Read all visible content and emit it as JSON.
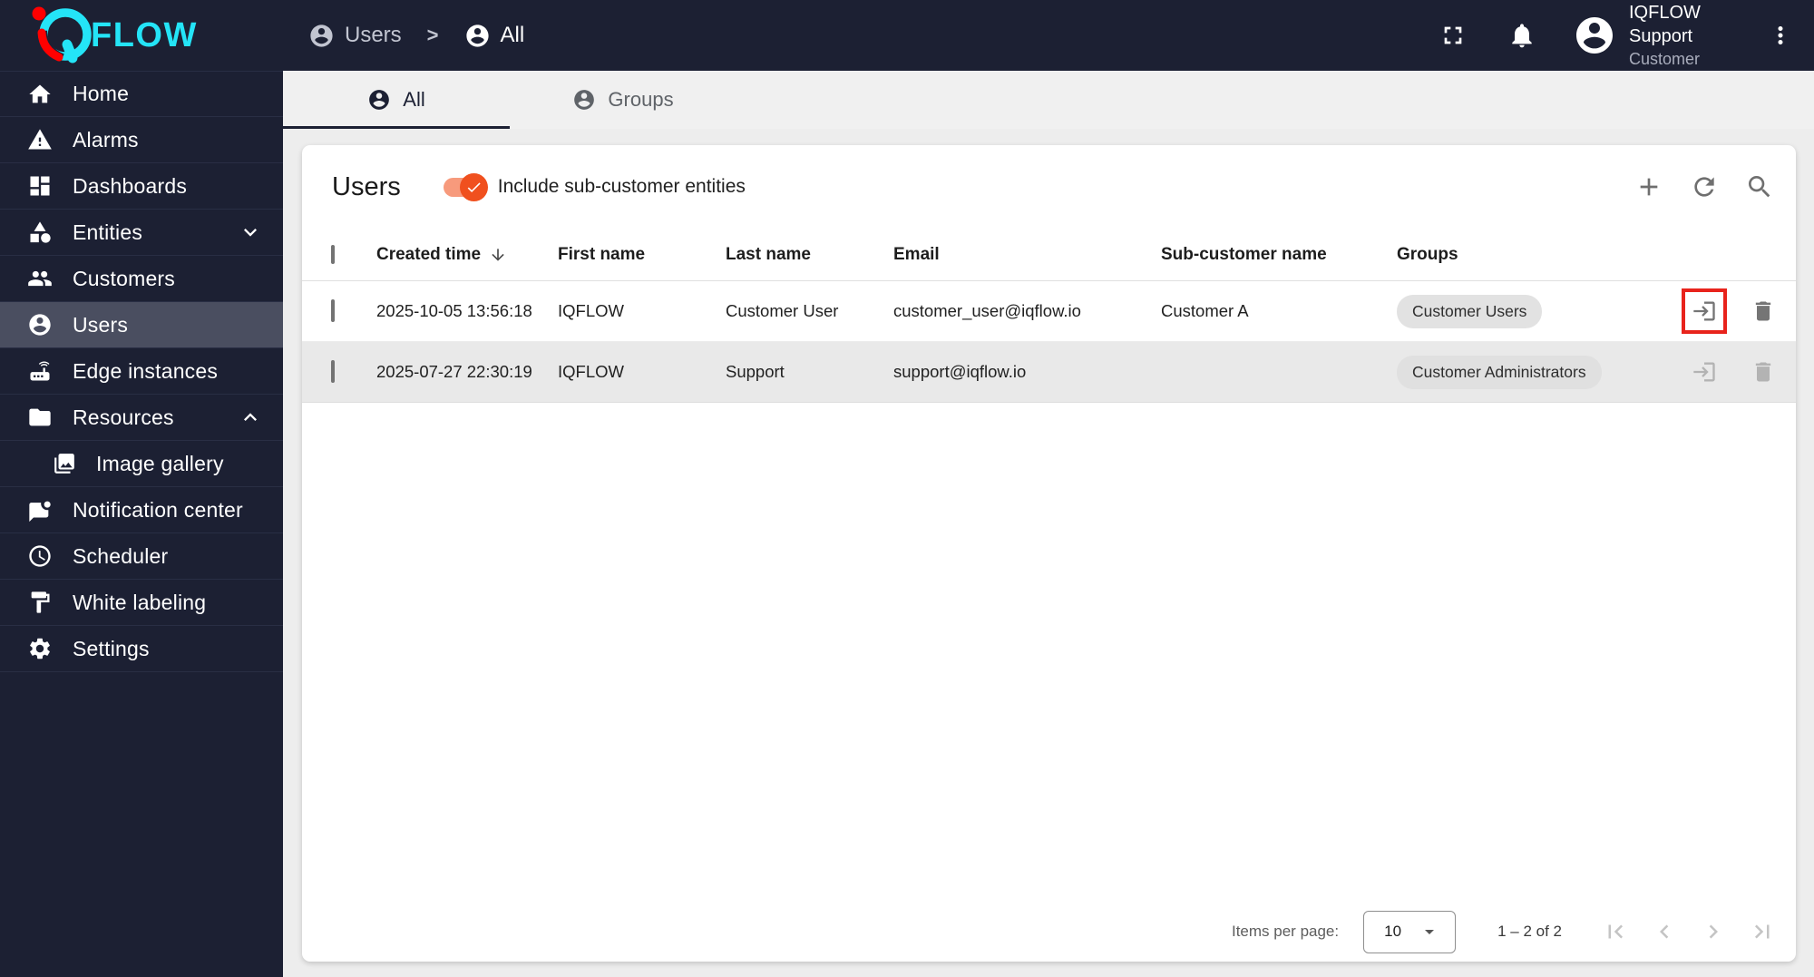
{
  "brand": {
    "mark": "iQ",
    "wordmark": "FLOW"
  },
  "colors": {
    "accent_cyan": "#24e4f7",
    "accent_red": "#ff0000",
    "sidebar_bg": "#1c2033",
    "selected_item_bg": "#4a4e60",
    "toggle_thumb": "#f0501e",
    "toggle_track": "#f79a7c",
    "annotation_red": "#e8231c"
  },
  "topbar": {
    "breadcrumb": {
      "level1": "Users",
      "separator": ">",
      "level2": "All"
    },
    "user_name": "IQFLOW Support",
    "user_role": "Customer",
    "icons": [
      "fullscreen-icon",
      "bell-icon",
      "avatar",
      "kebab-menu-icon"
    ]
  },
  "sidebar": {
    "items": [
      {
        "label": "Home",
        "icon": "home"
      },
      {
        "label": "Alarms",
        "icon": "warning"
      },
      {
        "label": "Dashboards",
        "icon": "dashboard"
      },
      {
        "label": "Entities",
        "icon": "category",
        "chevron": "down"
      },
      {
        "label": "Customers",
        "icon": "people"
      },
      {
        "label": "Users",
        "icon": "account",
        "selected": true
      },
      {
        "label": "Edge instances",
        "icon": "router"
      },
      {
        "label": "Resources",
        "icon": "folder",
        "chevron": "up"
      },
      {
        "label": "Image gallery",
        "icon": "gallery",
        "indented": true
      },
      {
        "label": "Notification center",
        "icon": "chat-unread"
      },
      {
        "label": "Scheduler",
        "icon": "clock"
      },
      {
        "label": "White labeling",
        "icon": "paint"
      },
      {
        "label": "Settings",
        "icon": "gear"
      }
    ]
  },
  "tabs": {
    "all": "All",
    "groups": "Groups"
  },
  "card": {
    "title": "Users",
    "toggle_label": "Include sub-customer entities",
    "toggle_on": true,
    "actions": [
      "add",
      "refresh",
      "search"
    ]
  },
  "table": {
    "headers": {
      "created": "Created time",
      "first": "First name",
      "last": "Last name",
      "email": "Email",
      "sub": "Sub-customer name",
      "groups": "Groups"
    },
    "sorted_by": "Created time",
    "sort_direction": "desc",
    "rows": [
      {
        "created": "2025-10-05 13:56:18",
        "first": "IQFLOW",
        "last": "Customer User",
        "email": "customer_user@iqflow.io",
        "sub": "Customer A",
        "group": "Customer Users",
        "login_annotated": true
      },
      {
        "created": "2025-07-27 22:30:19",
        "first": "IQFLOW",
        "last": "Support",
        "email": "support@iqflow.io",
        "sub": "",
        "group": "Customer Administrators",
        "disabled_actions": true
      }
    ]
  },
  "pagination": {
    "label": "Items per page:",
    "page_size": "10",
    "range": "1 – 2 of 2"
  }
}
